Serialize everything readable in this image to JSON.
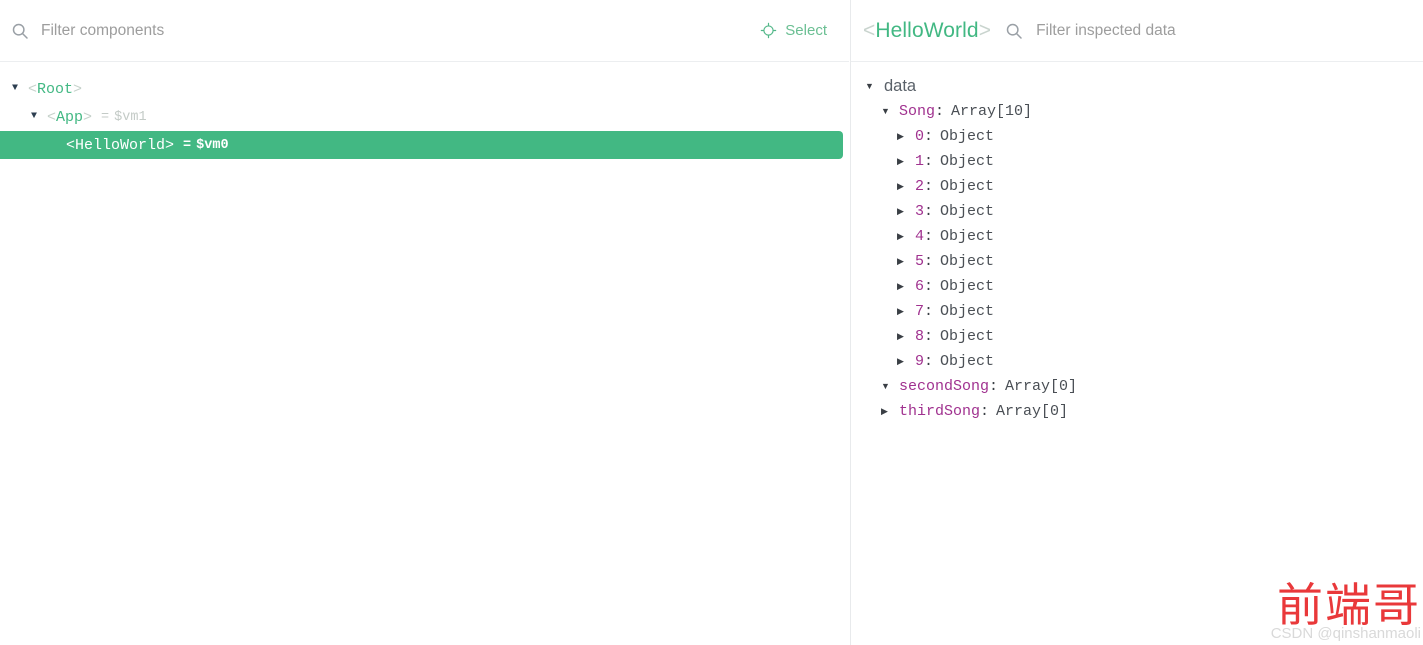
{
  "window": {
    "active_tab_indicator_color": "#73b999",
    "accent_color": "#42b883"
  },
  "components_panel": {
    "search": {
      "icon": "search-icon",
      "placeholder": "Filter components",
      "value": ""
    },
    "select_button": {
      "icon": "target-crosshair-icon",
      "label": "Select"
    },
    "tree": [
      {
        "arrow": "open",
        "indent": 0,
        "open_angle": "<",
        "name": "Root",
        "close_angle": ">",
        "equals": "",
        "vm": "",
        "selected": false
      },
      {
        "arrow": "open",
        "indent": 1,
        "open_angle": "<",
        "name": "App",
        "close_angle": ">",
        "equals": "=",
        "vm": "$vm1",
        "selected": false
      },
      {
        "arrow": "none",
        "indent": 2,
        "open_angle": "<",
        "name": "HelloWorld",
        "close_angle": ">",
        "equals": "=",
        "vm": "$vm0",
        "selected": true
      }
    ]
  },
  "inspector_panel": {
    "title": {
      "open_angle": "<",
      "name": "HelloWorld",
      "close_angle": ">"
    },
    "search": {
      "icon": "search-icon",
      "placeholder": "Filter inspected data",
      "value": ""
    },
    "data_group": {
      "arrow": "open",
      "label": "data"
    },
    "rows": [
      {
        "arrow": "open",
        "indent": 1,
        "key": "Song",
        "colon": ":",
        "value": "Array[10]"
      },
      {
        "arrow": "closed",
        "indent": 2,
        "key": "0",
        "colon": ":",
        "value": "Object"
      },
      {
        "arrow": "closed",
        "indent": 2,
        "key": "1",
        "colon": ":",
        "value": "Object"
      },
      {
        "arrow": "closed",
        "indent": 2,
        "key": "2",
        "colon": ":",
        "value": "Object"
      },
      {
        "arrow": "closed",
        "indent": 2,
        "key": "3",
        "colon": ":",
        "value": "Object"
      },
      {
        "arrow": "closed",
        "indent": 2,
        "key": "4",
        "colon": ":",
        "value": "Object"
      },
      {
        "arrow": "closed",
        "indent": 2,
        "key": "5",
        "colon": ":",
        "value": "Object"
      },
      {
        "arrow": "closed",
        "indent": 2,
        "key": "6",
        "colon": ":",
        "value": "Object"
      },
      {
        "arrow": "closed",
        "indent": 2,
        "key": "7",
        "colon": ":",
        "value": "Object"
      },
      {
        "arrow": "closed",
        "indent": 2,
        "key": "8",
        "colon": ":",
        "value": "Object"
      },
      {
        "arrow": "closed",
        "indent": 2,
        "key": "9",
        "colon": ":",
        "value": "Object"
      },
      {
        "arrow": "open",
        "indent": 1,
        "key": "secondSong",
        "colon": ":",
        "value": "Array[0]"
      },
      {
        "arrow": "closed",
        "indent": 1,
        "key": "thirdSong",
        "colon": ":",
        "value": "Array[0]"
      }
    ]
  },
  "watermark": {
    "title": "前端哥",
    "subtitle": "CSDN @qinshanmaoli"
  }
}
